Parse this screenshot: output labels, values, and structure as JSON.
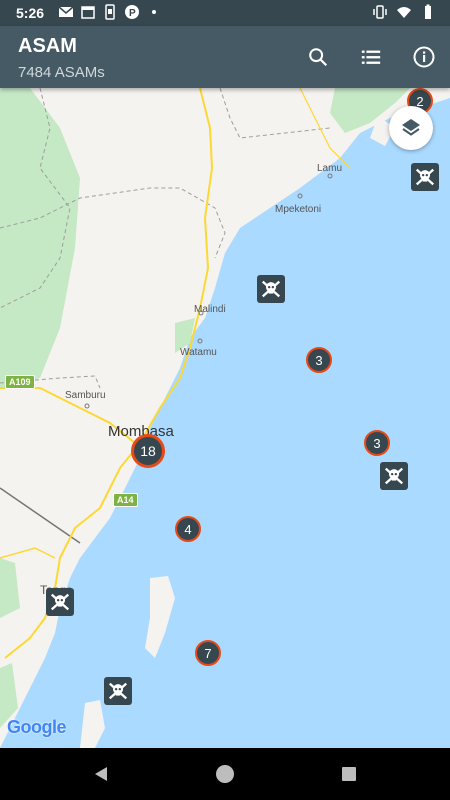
{
  "status_bar": {
    "time": "5:26"
  },
  "app_bar": {
    "title": "ASAM",
    "subtitle": "7484 ASAMs",
    "search_icon": "search-icon",
    "list_icon": "list-icon",
    "info_icon": "info-icon"
  },
  "map": {
    "labels": {
      "lamu": "Lamu",
      "mpeketoni": "Mpeketoni",
      "malindi": "Malindi",
      "watamu": "Watamu",
      "samburu": "Samburu",
      "mombasa": "Mombasa",
      "tanga": "Tanga"
    },
    "roads": {
      "a109": "A109",
      "a14": "A14"
    },
    "clusters": [
      "2",
      "3",
      "3",
      "18",
      "4",
      "7"
    ],
    "attribution": "Google",
    "colors": {
      "sea": "#aadaff",
      "land": "#f5f3ef",
      "park": "#c5e8c5",
      "cluster_fill": "#37474f",
      "cluster_ring": "#e64a19"
    }
  }
}
